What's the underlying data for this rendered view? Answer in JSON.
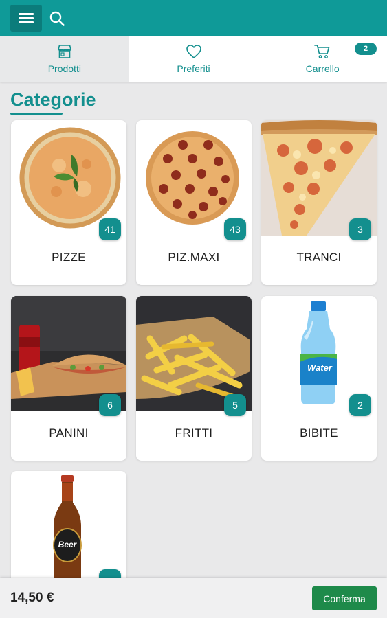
{
  "colors": {
    "primary": "#0f9a98",
    "accent": "#138f8e",
    "confirm": "#1e8a4a"
  },
  "header": {
    "menu_icon": "hamburger-menu-icon",
    "search_icon": "search-icon"
  },
  "tabs": [
    {
      "label": "Prodotti",
      "icon": "store-icon",
      "active": true
    },
    {
      "label": "Preferiti",
      "icon": "heart-icon",
      "active": false
    },
    {
      "label": "Carrello",
      "icon": "cart-icon",
      "active": false,
      "badge": "2"
    }
  ],
  "section_title": "Categorie",
  "categories": [
    {
      "name": "PIZZE",
      "count": "41",
      "image": "margherita-pizza-image"
    },
    {
      "name": "PIZ.MAXI",
      "count": "43",
      "image": "pepperoni-pizza-image"
    },
    {
      "name": "TRANCI",
      "count": "3",
      "image": "pizza-slice-image"
    },
    {
      "name": "PANINI",
      "count": "6",
      "image": "kebab-sandwich-image"
    },
    {
      "name": "FRITTI",
      "count": "5",
      "image": "french-fries-image"
    },
    {
      "name": "BIBITE",
      "count": "2",
      "image": "water-bottle-image"
    },
    {
      "name": "",
      "count": "",
      "image": "beer-bottle-image"
    }
  ],
  "water_label": "Water",
  "beer_label": "Beer",
  "footer": {
    "total": "14,50 €",
    "confirm_label": "Conferma"
  }
}
